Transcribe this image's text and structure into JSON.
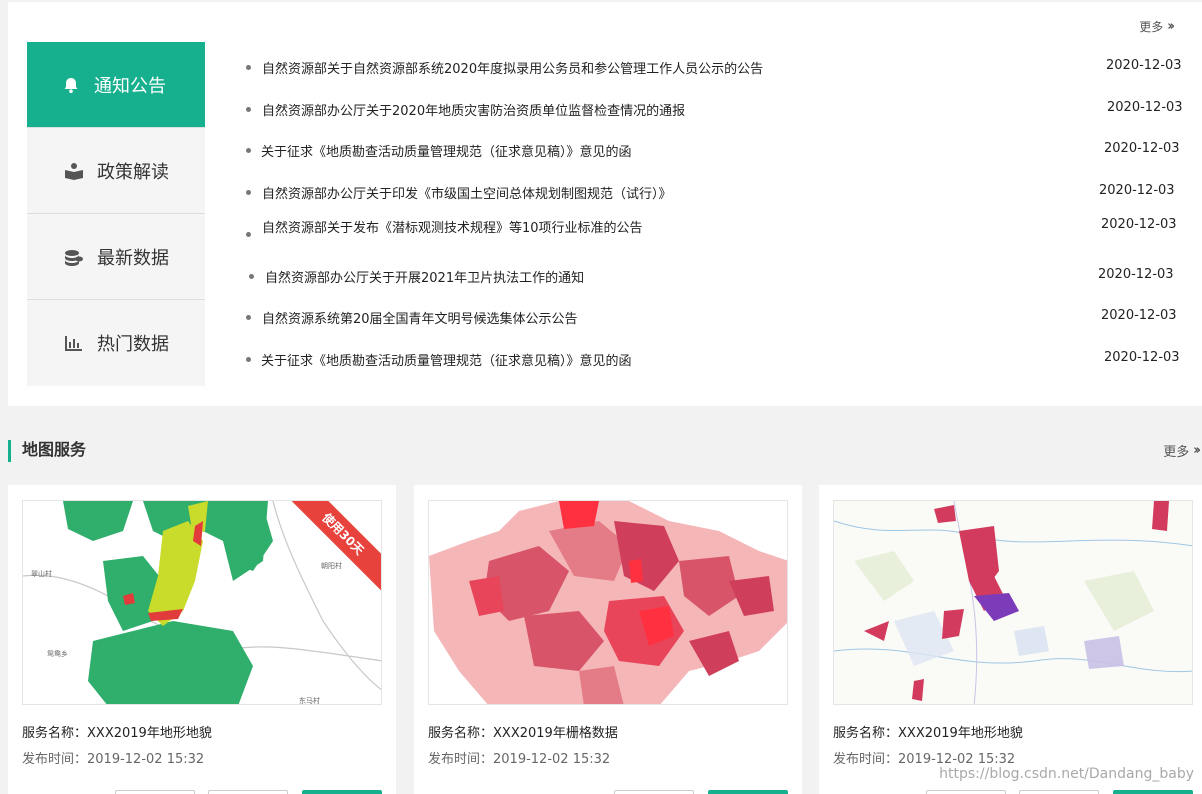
{
  "notice_panel": {
    "more_label": "更多",
    "tabs": [
      {
        "label": "通知公告",
        "icon": "bell-icon",
        "active": true
      },
      {
        "label": "政策解读",
        "icon": "book-icon",
        "active": false
      },
      {
        "label": "最新数据",
        "icon": "coins-icon",
        "active": false
      },
      {
        "label": "热门数据",
        "icon": "bar-chart-icon",
        "active": false
      }
    ],
    "items": [
      {
        "title": "自然资源部关于自然资源部系统2020年度拟录用公务员和参公管理工作人员公示的公告",
        "date": "2020-12-03"
      },
      {
        "title": "自然资源部办公厅关于2020年地质灾害防治资质单位监督检查情况的通报",
        "date": "2020-12-03"
      },
      {
        "title": "关于征求《地质勘查活动质量管理规范（征求意见稿）》意见的函",
        "date": "2020-12-03"
      },
      {
        "title": "自然资源部办公厅关于印发《市级国土空间总体规划制图规范（试行）》",
        "date": "2020-12-03"
      },
      {
        "title": "自然资源部关于发布《潜标观测技术规程》等10项行业标准的公告",
        "date": "2020-12-03"
      },
      {
        "title": "自然资源部办公厅关于开展2021年卫片执法工作的通知",
        "date": "2020-12-03"
      },
      {
        "title": "自然资源系统第20届全国青年文明号候选集体公示公告",
        "date": "2020-12-03"
      },
      {
        "title": "关于征求《地质勘查活动质量管理规范（征求意见稿）》意见的函",
        "date": "2020-12-03"
      }
    ]
  },
  "map_services": {
    "heading": "地图服务",
    "more_label": "更多",
    "cards": [
      {
        "name_label": "服务名称：",
        "name": "XXX2019年地形地貌",
        "time_label": "发布时间：",
        "time": "2019-12-02  15:32",
        "ribbon": "使用30天",
        "map_labels": [
          "翠山村",
          "鸳鸯乡",
          "朝阳村",
          "东马村"
        ]
      },
      {
        "name_label": "服务名称：",
        "name": "XXX2019年栅格数据",
        "time_label": "发布时间：",
        "time": "2019-12-02  15:32",
        "ribbon": ""
      },
      {
        "name_label": "服务名称：",
        "name": "XXX2019年地形地貌",
        "time_label": "发布时间：",
        "time": "2019-12-02  15:32",
        "ribbon": ""
      }
    ]
  },
  "watermark": "https://blog.csdn.net/Dandang_baby",
  "colors": {
    "accent": "#17b08e",
    "ribbon": "#e8423c"
  }
}
